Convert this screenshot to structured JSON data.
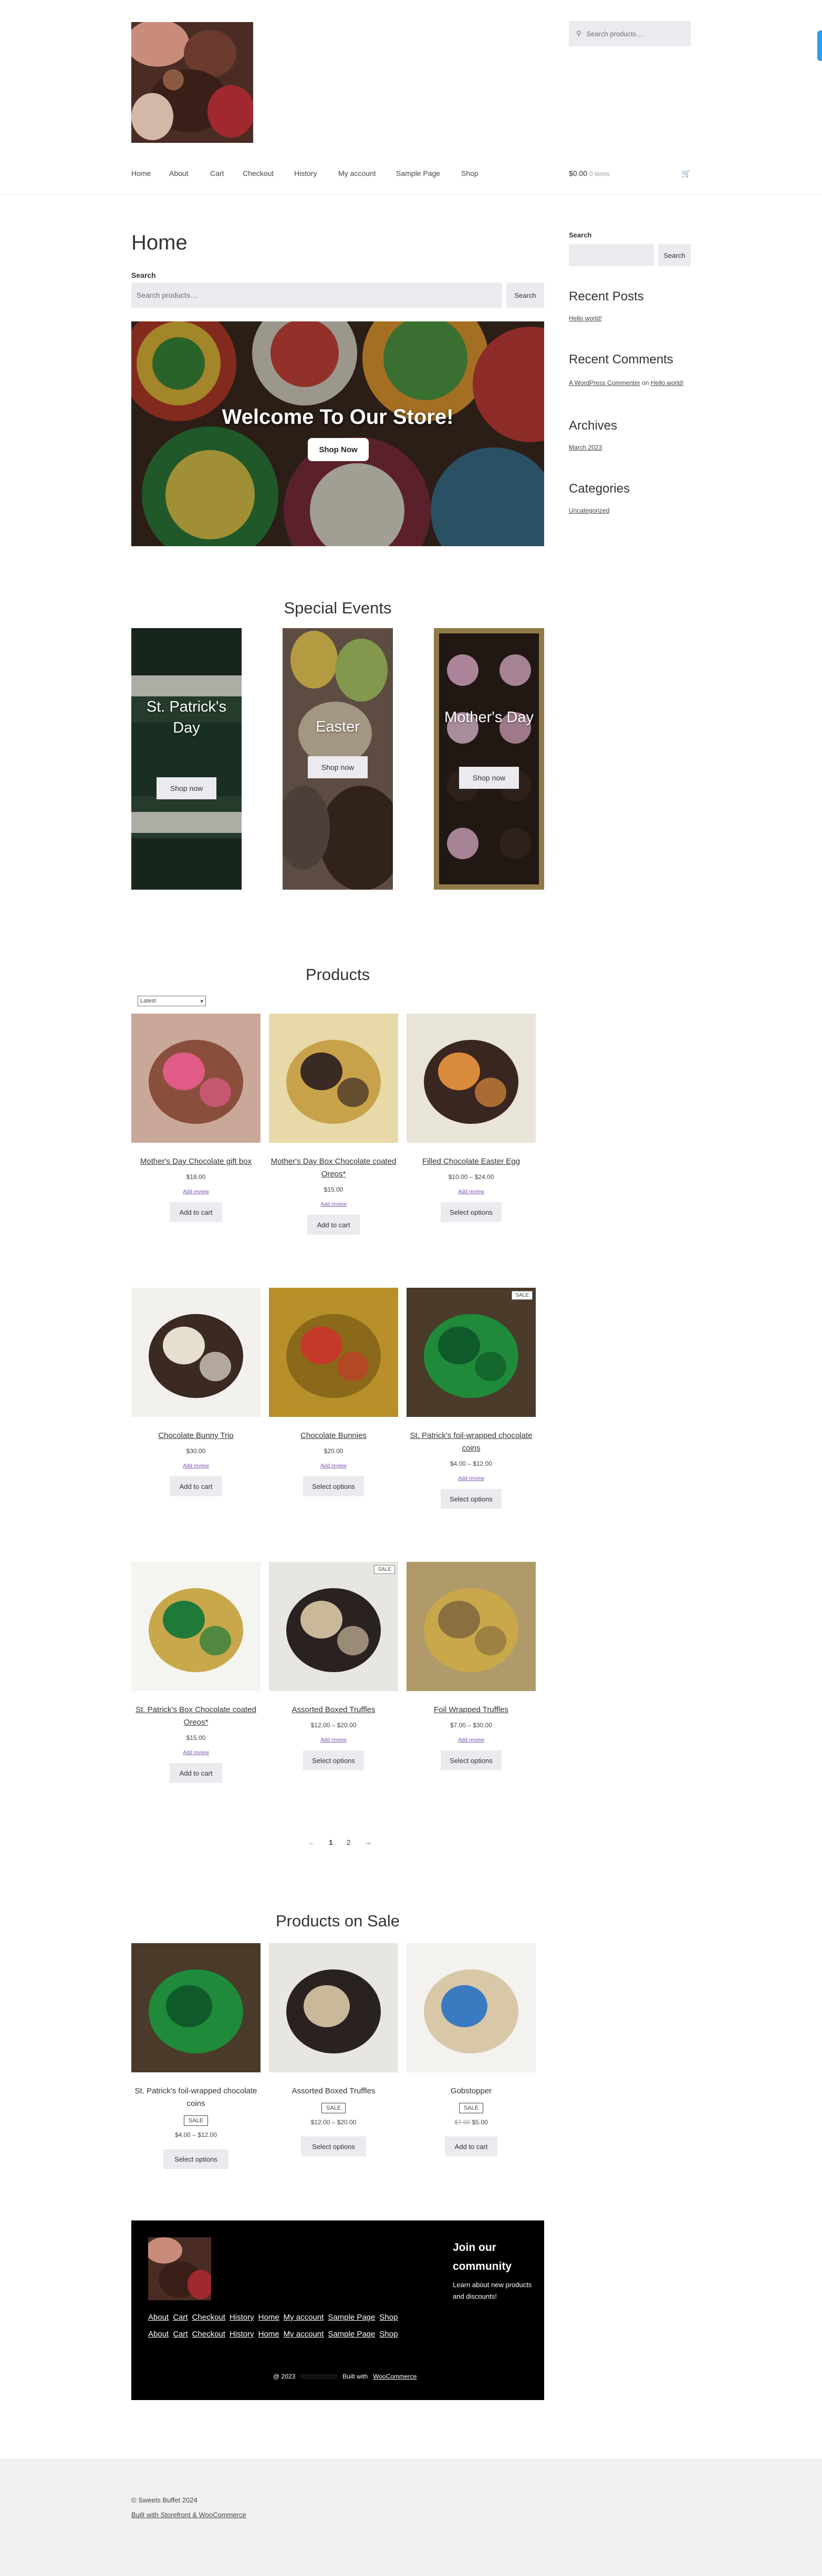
{
  "header": {
    "search_placeholder": "Search products…",
    "nav": [
      "Home",
      "About",
      "Cart",
      "Checkout",
      "History",
      "My account",
      "Sample Page",
      "Shop"
    ],
    "cart_total": "$0.00",
    "cart_items": "0 items"
  },
  "main": {
    "title": "Home",
    "search_label": "Search",
    "search_placeholder": "Search products…",
    "search_button": "Search",
    "hero_title": "Welcome To Our Store!",
    "hero_button": "Shop Now",
    "events_title": "Special Events",
    "events": [
      {
        "title": "St. Patrick's Day",
        "button": "Shop now"
      },
      {
        "title": "Easter",
        "button": "Shop now"
      },
      {
        "title": "Mother's Day",
        "button": "Shop now"
      }
    ],
    "products_title": "Products",
    "sort_value": "Latest",
    "products": [
      {
        "name": "Mother's Day Chocolate gift box",
        "price": "$18.00",
        "reviews": "Add review",
        "button": "Add to cart",
        "sale": false
      },
      {
        "name": "Mother's Day Box Chocolate coated Oreos*",
        "price": "$15.00",
        "reviews": "Add review",
        "button": "Add to cart",
        "sale": false
      },
      {
        "name": "Filled Chocolate Easter Egg",
        "price": "$10.00 – $24.00",
        "reviews": "Add review",
        "button": "Select options",
        "sale": false
      },
      {
        "name": "Chocolate Bunny Trio",
        "price": "$30.00",
        "reviews": "Add review",
        "button": "Add to cart",
        "sale": false
      },
      {
        "name": "Chocolate Bunnies",
        "price": "$20.00",
        "reviews": "Add review",
        "button": "Select options",
        "sale": false
      },
      {
        "name": "St. Patrick's foil-wrapped chocolate coins",
        "price": "$4.00 – $12.00",
        "reviews": "Add review",
        "button": "Select options",
        "sale": true
      },
      {
        "name": "St. Patrick's Box Chocolate coated Oreos*",
        "price": "$15.00",
        "reviews": "Add review",
        "button": "Add to cart",
        "sale": false
      },
      {
        "name": "Assorted Boxed Truffles",
        "price": "$12.00 – $20.00",
        "reviews": "Add review",
        "button": "Select options",
        "sale": true
      },
      {
        "name": "Foil Wrapped Truffles",
        "price": "$7.00 – $30.00",
        "reviews": "Add review",
        "button": "Select options",
        "sale": false
      }
    ],
    "pagination": [
      "←",
      "1",
      "2",
      "→"
    ],
    "sale_title": "Products on Sale",
    "sale_badge": "SALE",
    "sale_products": [
      {
        "name": "St. Patrick's foil-wrapped chocolate coins",
        "price": "$4.00 – $12.00",
        "old_price": "",
        "button": "Select options"
      },
      {
        "name": "Assorted Boxed Truffles",
        "price": "$12.00 – $20.00",
        "old_price": "",
        "button": "Select options"
      },
      {
        "name": "Gobstopper",
        "price": "$5.00",
        "old_price": "$7.00",
        "button": "Add to cart"
      }
    ]
  },
  "sidebar": {
    "search_label": "Search",
    "search_button": "Search",
    "recent_posts_title": "Recent Posts",
    "recent_post": "Hello world!",
    "recent_comments_title": "Recent Comments",
    "comment_author": "A WordPress Commenter",
    "comment_on": "on",
    "comment_post": "Hello world!",
    "archives_title": "Archives",
    "archive": "March 2023",
    "categories_title": "Categories",
    "category": "Uncategorized"
  },
  "footer_block": {
    "join_title": "Join our community",
    "join_text": "Learn about new products and discounts!",
    "links": [
      "About",
      "Cart",
      "Checkout",
      "History",
      "Home",
      "My account",
      "Sample Page",
      "Shop"
    ],
    "copy": "@ 2023",
    "built_with": "Built with",
    "woocommerce": "WooCommerce"
  },
  "site_footer": {
    "copyright": "© Sweets Buffet 2024",
    "credit": "Built with Storefront & WooCommerce"
  },
  "colors": {
    "accent": "#7f54b3",
    "button_bg": "#ebeaee",
    "cta_blue": "#2c9df0"
  }
}
